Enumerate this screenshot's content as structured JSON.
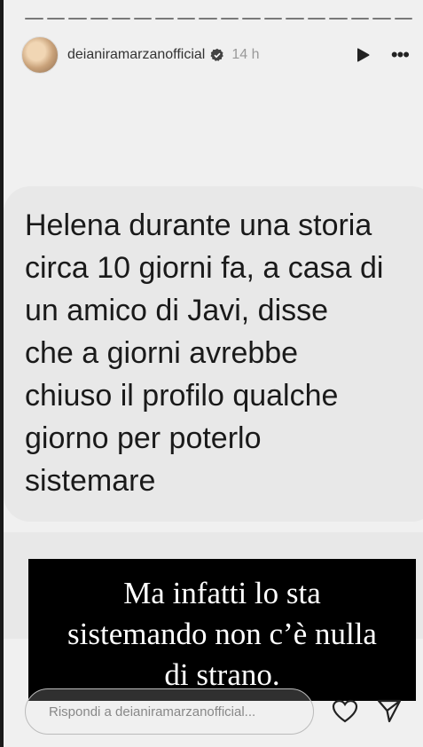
{
  "story": {
    "progress_segments": 18,
    "username": "deianiramarzanofficial",
    "time_ago": "14 h",
    "icons": {
      "avatar": "profile-photo",
      "verified": "verified-badge-icon",
      "play": "play-icon",
      "more": "more-options-icon"
    },
    "more_label": "•••",
    "message_text": "Helena durante una storia\ncirca 10 giorni fa, a casa di\nun amico di Javi, disse\nche a giorni avrebbe\nchiuso il profilo qualche\ngiorno per poterlo\nsistemare",
    "caption_text": "Ma infatti lo sta\nsistemando non c’è nulla\ndi strano."
  },
  "reply": {
    "placeholder": "Rispondi a deianiramarzanofficial...",
    "heart_icon": "heart-icon",
    "send_icon": "send-icon"
  },
  "colors": {
    "story_background": "#f0f0f0",
    "bubble": "#e8e8e8",
    "caption_background": "#000000",
    "caption_text": "#ffffff"
  }
}
